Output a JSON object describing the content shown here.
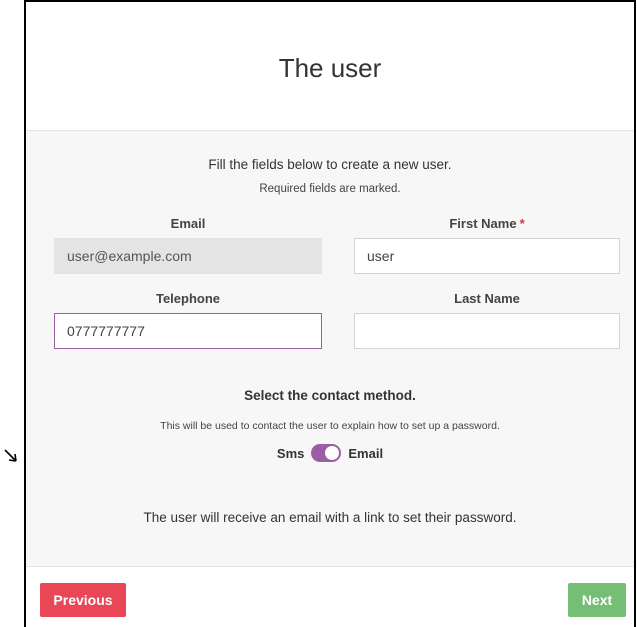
{
  "modal": {
    "title": "The user",
    "intro": "Fill the fields below to create a new user.",
    "required_note": "Required fields are marked."
  },
  "form": {
    "email": {
      "label": "Email",
      "value": "user@example.com"
    },
    "first_name": {
      "label": "First Name",
      "required_mark": "*",
      "value": "user"
    },
    "telephone": {
      "label": "Telephone",
      "value": "0777777777"
    },
    "last_name": {
      "label": "Last Name",
      "value": ""
    }
  },
  "contact_method": {
    "title": "Select the contact method.",
    "description": "This will be used to contact the user to explain how to set up a password.",
    "option_left": "Sms",
    "option_right": "Email",
    "selected": "Email",
    "result_text": "The user will receive an email with a link to set their password."
  },
  "footer": {
    "previous_label": "Previous",
    "next_label": "Next"
  },
  "colors": {
    "accent_purple": "#9b5ea4",
    "previous_red": "#e94656",
    "next_green": "#74bf75",
    "required_red": "#d9313f"
  },
  "icons": {
    "pointer": "arrow-pointer-icon"
  }
}
